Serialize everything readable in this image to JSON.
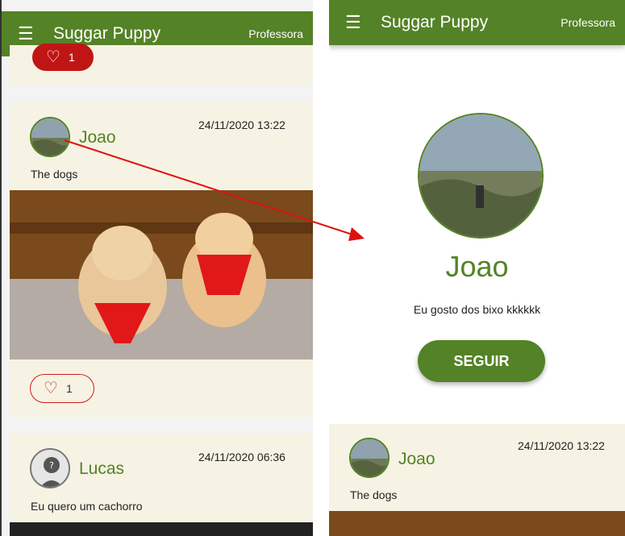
{
  "app": {
    "title": "Suggar Puppy",
    "user_label": "Professora"
  },
  "feed": {
    "likes_top": "1",
    "posts": [
      {
        "author": "Joao",
        "date": "24/11/2020 13:22",
        "caption": "The dogs",
        "likes": "1"
      },
      {
        "author": "Lucas",
        "date": "24/11/2020 06:36",
        "caption": "Eu quero um cachorro"
      }
    ]
  },
  "profile": {
    "name": "Joao",
    "bio": "Eu gosto dos bixo kkkkkk",
    "follow_label": "SEGUIR"
  },
  "profile_posts": [
    {
      "author": "Joao",
      "date": "24/11/2020 13:22",
      "caption": "The dogs"
    }
  ],
  "colors": {
    "primary": "#548226",
    "card": "#f6f3e4",
    "like": "#d51c1c",
    "annotation_arrow": "#e01010"
  }
}
